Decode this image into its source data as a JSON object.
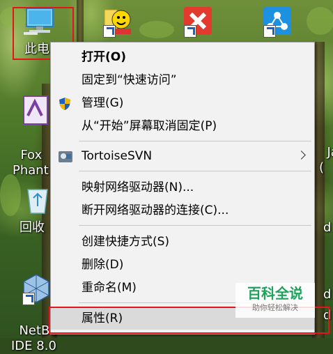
{
  "desktop": {
    "icons": [
      {
        "name": "this-pc",
        "label": "此电"
      },
      {
        "name": "foxit",
        "label": "Fox\nPhant"
      },
      {
        "name": "recycle",
        "label": "回收"
      },
      {
        "name": "netbeans",
        "label": "NetBe\nIDE 8.0"
      },
      {
        "name": "java-right",
        "label": "Jav\n("
      },
      {
        "name": "right-d1",
        "label": "d"
      },
      {
        "name": "right-d2",
        "label": "d"
      },
      {
        "name": "right-d3",
        "label": "d"
      }
    ]
  },
  "context_menu": {
    "items": [
      {
        "id": "open",
        "label": "打开(O)"
      },
      {
        "id": "pin-quick",
        "label": "固定到“快速访问”"
      },
      {
        "id": "manage",
        "label": "管理(G)"
      },
      {
        "id": "unpin-start",
        "label": "从“开始”屏幕取消固定(P)"
      },
      {
        "id": "tortoisesvn",
        "label": "TortoiseSVN"
      },
      {
        "id": "map-drive",
        "label": "映射网络驱动器(N)..."
      },
      {
        "id": "disconnect-drive",
        "label": "断开网络驱动器的连接(C)..."
      },
      {
        "id": "create-shortcut",
        "label": "创建快捷方式(S)"
      },
      {
        "id": "delete",
        "label": "删除(D)"
      },
      {
        "id": "rename",
        "label": "重命名(M)"
      },
      {
        "id": "properties",
        "label": "属性(R)"
      }
    ]
  },
  "watermark": {
    "title": "百科全说",
    "subtitle": "助你轻松解决"
  },
  "colors": {
    "highlight": "#e3141b",
    "menu_bg": "#f2f2f2",
    "watermark_green": "#1fa35c"
  }
}
